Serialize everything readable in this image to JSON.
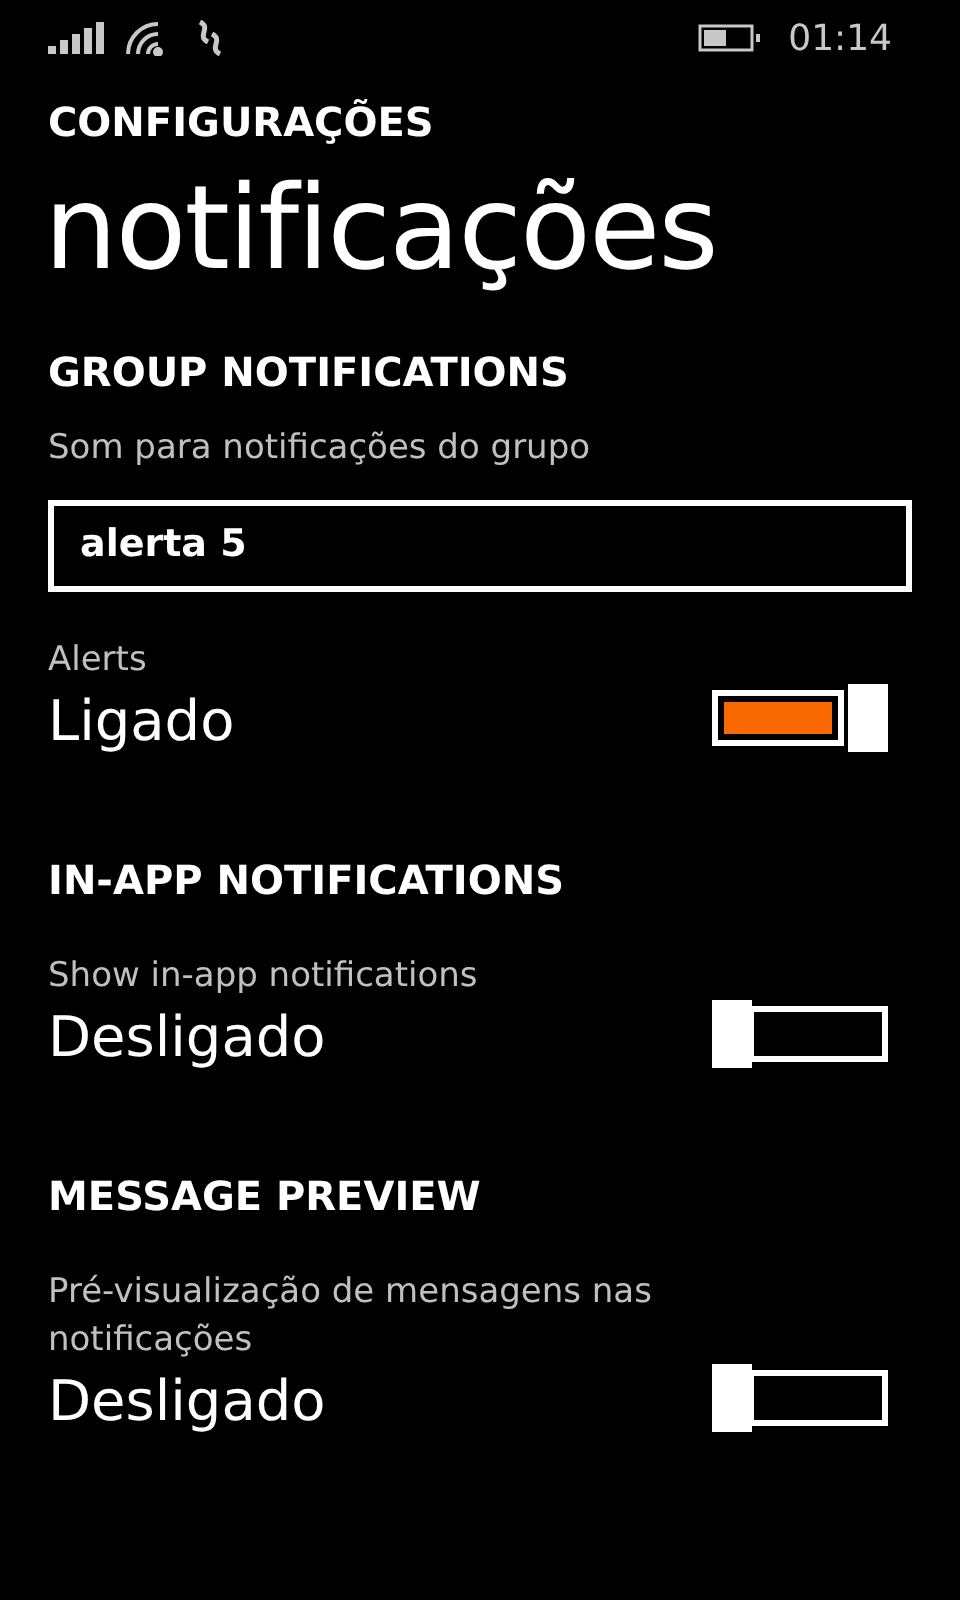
{
  "status_bar": {
    "time": "01:14"
  },
  "header": "CONFIGURAÇÕES",
  "title": "notificações",
  "sections": [
    {
      "heading": "GROUP NOTIFICATIONS",
      "items": [
        {
          "kind": "select",
          "label": "Som para notificações do grupo",
          "value": "alerta 5"
        },
        {
          "kind": "toggle",
          "label": "Alerts",
          "value": "Ligado",
          "on": true
        }
      ]
    },
    {
      "heading": "IN-APP NOTIFICATIONS",
      "items": [
        {
          "kind": "toggle",
          "label": "Show in-app notifications",
          "value": "Desligado",
          "on": false
        }
      ]
    },
    {
      "heading": "MESSAGE PREVIEW",
      "items": [
        {
          "kind": "toggle",
          "label": "Pré-visualização de mensagens nas notificações",
          "value": "Desligado",
          "on": false
        }
      ]
    }
  ]
}
